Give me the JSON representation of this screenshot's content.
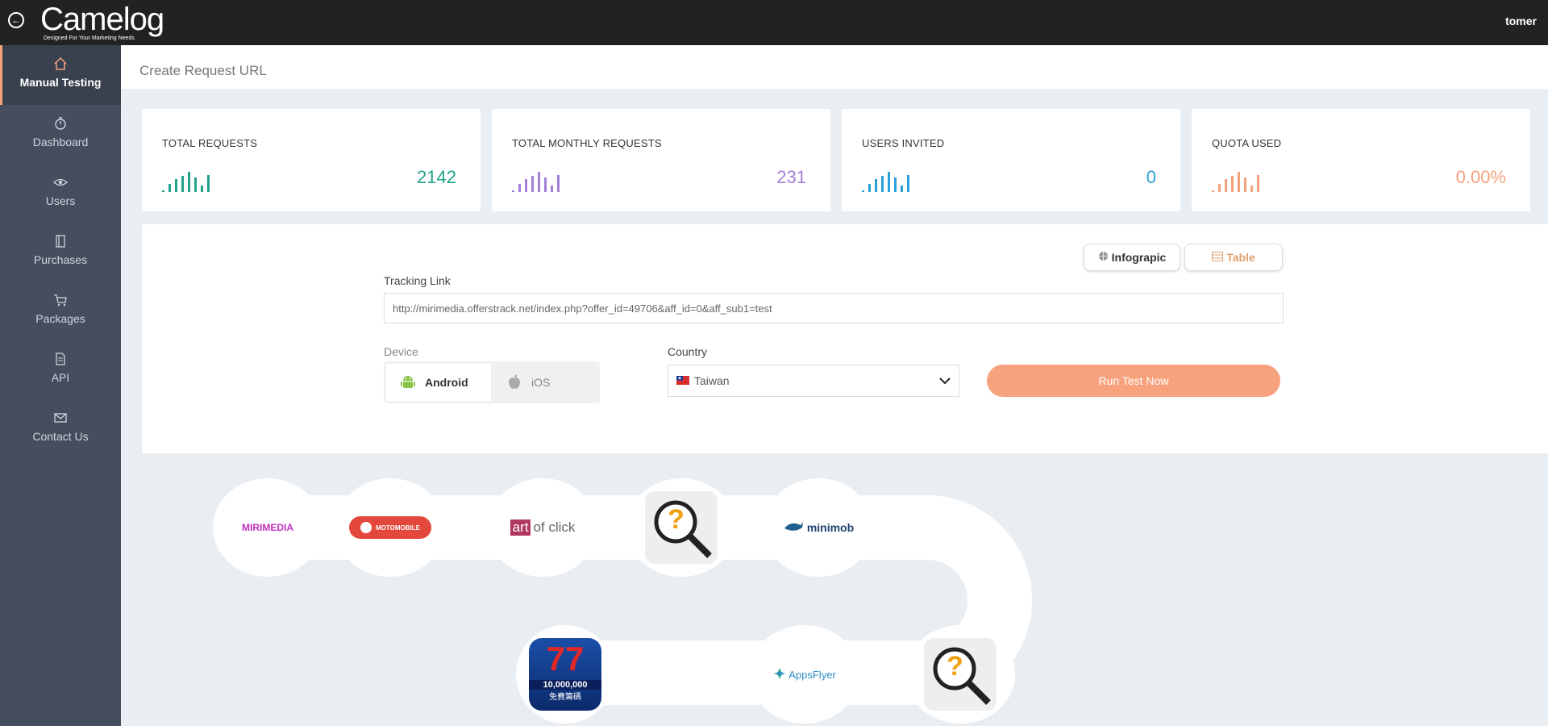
{
  "app": {
    "logo_name": "Camelog",
    "logo_tagline": "Designed For Your Marketing Needs",
    "user": "tomer"
  },
  "sidebar": {
    "items": [
      {
        "label": "Manual Testing",
        "icon": "home-icon",
        "active": true
      },
      {
        "label": "Dashboard",
        "icon": "stopwatch-icon"
      },
      {
        "label": "Users",
        "icon": "eye-icon"
      },
      {
        "label": "Purchases",
        "icon": "book-icon"
      },
      {
        "label": "Packages",
        "icon": "cart-icon"
      },
      {
        "label": "API",
        "icon": "document-icon"
      },
      {
        "label": "Contact Us",
        "icon": "mail-icon"
      }
    ]
  },
  "page": {
    "title": "Create Request URL"
  },
  "stats": [
    {
      "label": "TOTAL REQUESTS",
      "value": "2142",
      "color": "#21a38a"
    },
    {
      "label": "TOTAL MONTHLY REQUESTS",
      "value": "231",
      "color": "#a37fd6"
    },
    {
      "label": "USERS INVITED",
      "value": "0",
      "color": "#2a9fd8"
    },
    {
      "label": "QUOTA USED",
      "value": "0.00%",
      "color": "#f4a27c"
    }
  ],
  "view_toggle": {
    "infographic": "Infograpic",
    "table": "Table"
  },
  "form": {
    "tracking_label": "Tracking Link",
    "tracking_value": "http://mirimedia.offerstrack.net/index.php?offer_id=49706&aff_id=0&aff_sub1=test",
    "device_label": "Device",
    "device_android": "Android",
    "device_ios": "iOS",
    "country_label": "Country",
    "country_value": "Taiwan",
    "run_button": "Run Test Now"
  },
  "flow": {
    "nodes": [
      {
        "label": "MIRIMEDIA"
      },
      {
        "label": "MOTOMOBILE"
      },
      {
        "label_box": "art",
        "label_rest": "of click"
      },
      {
        "label": "?"
      },
      {
        "label": "minimob"
      },
      {
        "label": "?"
      },
      {
        "label": "AppsFlyer"
      },
      {
        "label_line1": "10,000,000",
        "label_line2": "免費籌碼"
      }
    ]
  }
}
